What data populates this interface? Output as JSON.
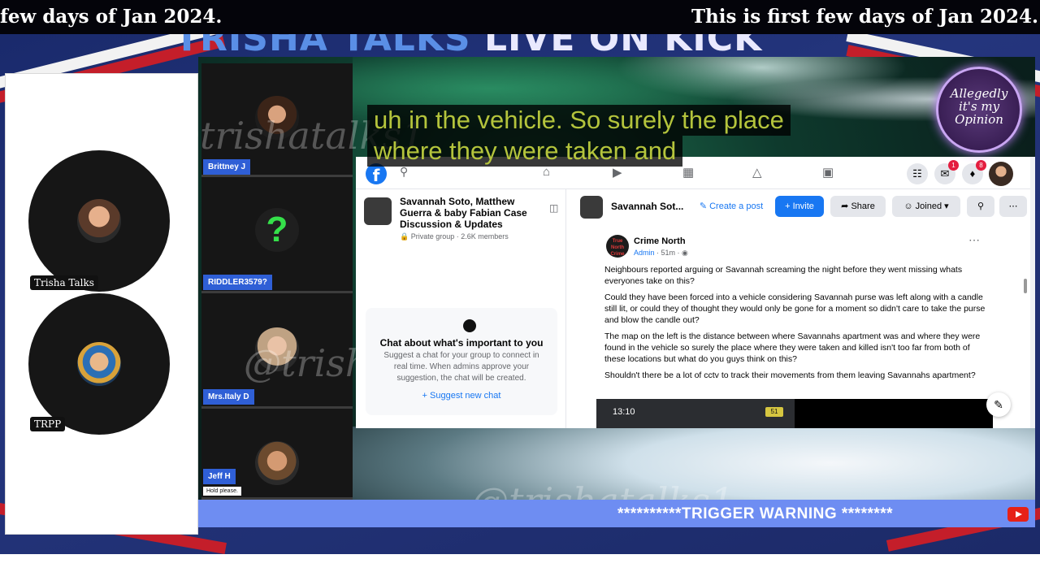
{
  "marquee": {
    "left_text": "few days of Jan 2024.",
    "right_text": "This is first few days of Jan 2024."
  },
  "banner": {
    "title_part1": "TRISHA TALKS",
    "title_part2": "LIVE ON KICK"
  },
  "cameras": [
    {
      "name": "Trisha Talks"
    },
    {
      "name": "TRPP"
    }
  ],
  "participants": [
    {
      "name": "Brittney J",
      "sub": ""
    },
    {
      "name": "RIDDLER3579?",
      "sub": ""
    },
    {
      "name": "Mrs.Italy D",
      "sub": ""
    },
    {
      "name": "Jeff H",
      "sub": "Hold please."
    }
  ],
  "caption": {
    "line1": "uh in the vehicle. So surely the place",
    "line2": "where they were taken and"
  },
  "watermarks": {
    "handle1": "@trishatalks1",
    "handle2": "@trisha",
    "handle3": "@trishatalks1"
  },
  "logo": {
    "line1": "Allegedly",
    "line2": "it's my",
    "line3": "Opinion"
  },
  "facebook": {
    "logo_letter": "f",
    "search_icon": "search-icon",
    "nav_icons": [
      "home-icon",
      "video-icon",
      "marketplace-icon",
      "gaming-icon",
      "groups-icon"
    ],
    "right_icons": [
      {
        "icon": "menu-grid-icon",
        "badge": ""
      },
      {
        "icon": "messenger-icon",
        "badge": "1"
      },
      {
        "icon": "bell-icon",
        "badge": "8"
      }
    ],
    "group": {
      "name": "Savannah Soto, Matthew Guerra & baby Fabian Case Discussion & Updates",
      "privacy": "Private group",
      "members": "2.6K members"
    },
    "chat_card": {
      "title": "Chat about what's important to you",
      "description": "Suggest a chat for your group to connect in real time. When admins approve your suggestion, the chat will be created.",
      "action": "+ Suggest new chat"
    },
    "group_bar": {
      "title": "Savannah Sot...",
      "create_post": "Create a post",
      "invite": "+ Invite",
      "share": "Share",
      "joined": "Joined"
    },
    "post": {
      "avatar_text": "True North Crime",
      "author": "Crime North",
      "role": "Admin",
      "time": "51m",
      "paragraphs": [
        "Neighbours reported arguing or Savannah screaming the night before they went missing whats everyones take on this?",
        "Could they have been forced into a vehicle considering Savannah purse was left along with a candle still lit, or could they of thought they would only be gone for a moment so didn't care to take the purse and blow the candle out?",
        "The map on the left is the distance between where Savannahs apartment was and where they were found in the vehicle so surely the place where they were taken and killed isn't too far from both of these locations but what do you guys think on this?",
        "Shouldn't there be a lot of cctv to track their movements from them leaving Savannahs apartment?"
      ],
      "media_time": "13:10",
      "battery": "51"
    }
  },
  "trigger_warning": "**********TRIGGER WARNING ********",
  "colors": {
    "facebook_blue": "#1877f2",
    "caption_text": "#b4c43c",
    "trigger_bar": "#6e8df2",
    "participant_label": "#2f5fd6"
  }
}
